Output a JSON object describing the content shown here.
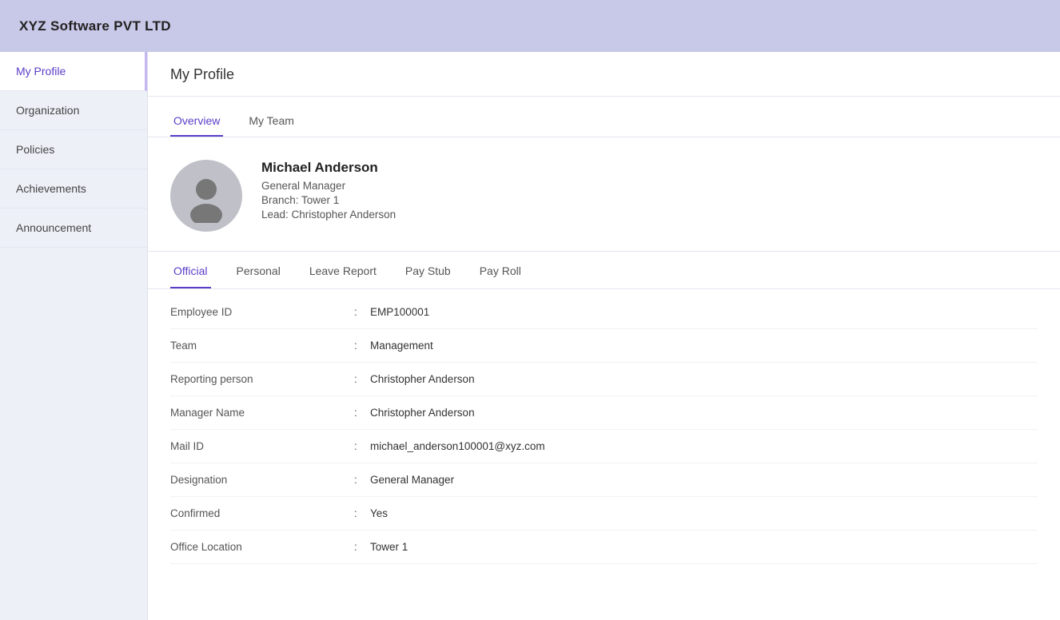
{
  "app": {
    "title": "XYZ Software PVT LTD"
  },
  "sidebar": {
    "items": [
      {
        "id": "my-profile",
        "label": "My Profile",
        "active": true
      },
      {
        "id": "organization",
        "label": "Organization",
        "active": false
      },
      {
        "id": "policies",
        "label": "Policies",
        "active": false
      },
      {
        "id": "achievements",
        "label": "Achievements",
        "active": false
      },
      {
        "id": "announcement",
        "label": "Announcement",
        "active": false
      }
    ]
  },
  "page": {
    "title": "My Profile"
  },
  "overview_tabs": [
    {
      "id": "overview",
      "label": "Overview",
      "active": true
    },
    {
      "id": "my-team",
      "label": "My Team",
      "active": false
    }
  ],
  "profile": {
    "name": "Michael Anderson",
    "role": "General Manager",
    "branch": "Branch: Tower 1",
    "lead": "Lead: Christopher Anderson"
  },
  "sub_tabs": [
    {
      "id": "official",
      "label": "Official",
      "active": true
    },
    {
      "id": "personal",
      "label": "Personal",
      "active": false
    },
    {
      "id": "leave-report",
      "label": "Leave Report",
      "active": false
    },
    {
      "id": "pay-stub",
      "label": "Pay Stub",
      "active": false
    },
    {
      "id": "pay-roll",
      "label": "Pay Roll",
      "active": false
    }
  ],
  "fields": [
    {
      "label": "Employee ID",
      "value": "EMP100001"
    },
    {
      "label": "Team",
      "value": "Management"
    },
    {
      "label": "Reporting person",
      "value": "Christopher Anderson"
    },
    {
      "label": "Manager Name",
      "value": "Christopher Anderson"
    },
    {
      "label": "Mail ID",
      "value": "michael_anderson100001@xyz.com"
    },
    {
      "label": "Designation",
      "value": "General Manager"
    },
    {
      "label": "Confirmed",
      "value": "Yes"
    },
    {
      "label": "Office Location",
      "value": "Tower 1"
    }
  ],
  "colors": {
    "accent": "#5b3ec8",
    "header_bg": "#c8c8e8",
    "sidebar_bg": "#eef0f8"
  }
}
